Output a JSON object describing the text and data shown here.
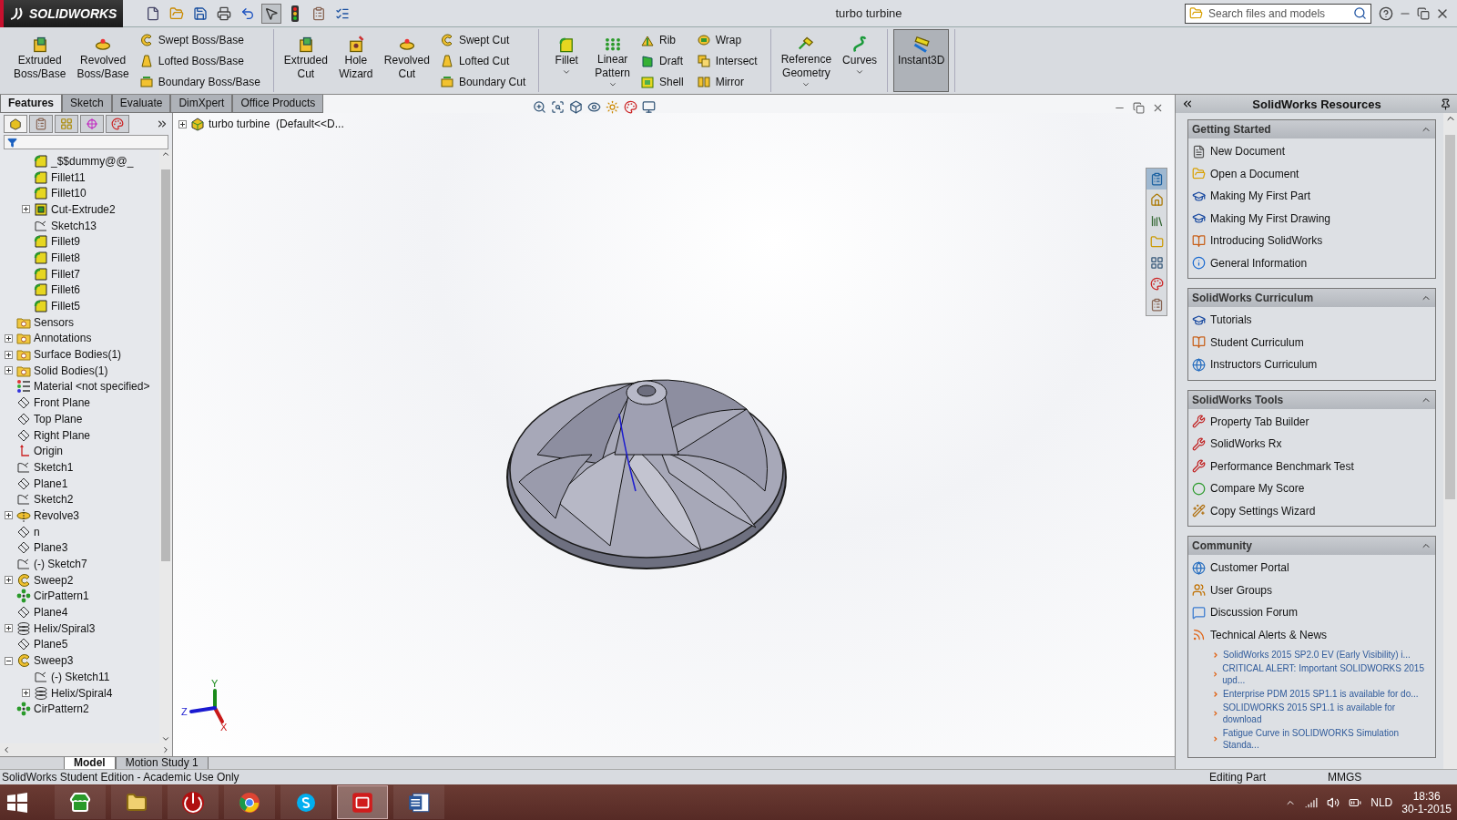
{
  "app": {
    "logo": "SOLIDWORKS",
    "title": "turbo turbine",
    "search": {
      "placeholder": "Search files and models"
    }
  },
  "command_groups": [
    [
      {
        "kind": "large",
        "label": "Extruded\nBoss/Base"
      },
      {
        "kind": "large",
        "label": "Revolved\nBoss/Base"
      },
      {
        "kind": "small",
        "label": "Swept Boss/Base"
      },
      {
        "kind": "small",
        "label": "Lofted Boss/Base"
      },
      {
        "kind": "small",
        "label": "Boundary Boss/Base"
      }
    ],
    [
      {
        "kind": "large",
        "label": "Extruded\nCut"
      },
      {
        "kind": "large",
        "label": "Hole\nWizard"
      },
      {
        "kind": "large",
        "label": "Revolved\nCut"
      },
      {
        "kind": "small",
        "label": "Swept Cut"
      },
      {
        "kind": "small",
        "label": "Lofted Cut"
      },
      {
        "kind": "small",
        "label": "Boundary Cut"
      }
    ],
    [
      {
        "kind": "large",
        "label": "Fillet",
        "dropdown": true
      },
      {
        "kind": "large",
        "label": "Linear\nPattern",
        "dropdown": true
      },
      {
        "kind": "small",
        "label": "Rib"
      },
      {
        "kind": "small",
        "label": "Draft"
      },
      {
        "kind": "small",
        "label": "Shell"
      },
      {
        "kind": "small",
        "label": "Wrap"
      },
      {
        "kind": "small",
        "label": "Intersect"
      },
      {
        "kind": "small",
        "label": "Mirror"
      }
    ],
    [
      {
        "kind": "large",
        "label": "Reference\nGeometry",
        "dropdown": true
      },
      {
        "kind": "large",
        "label": "Curves",
        "dropdown": true
      }
    ],
    [
      {
        "kind": "large",
        "label": "Instant3D",
        "selected": true
      }
    ]
  ],
  "tabs": [
    {
      "label": "Features",
      "selected": true
    },
    {
      "label": "Sketch",
      "selected": false
    },
    {
      "label": "Evaluate",
      "selected": false
    },
    {
      "label": "DimXpert",
      "selected": false
    },
    {
      "label": "Office Products",
      "selected": false
    }
  ],
  "tree": {
    "root": "turbo turbine  (Default<<D...",
    "items": [
      {
        "children": [
          {
            "label": "_$$dummy@@_",
            "kind": "feature"
          },
          {
            "label": "Fillet11",
            "kind": "feature"
          },
          {
            "label": "Fillet10",
            "kind": "feature"
          },
          {
            "label": "Cut-Extrude2",
            "kind": "cut",
            "expanded": false
          },
          {
            "label": "Sketch13",
            "kind": "sketch"
          },
          {
            "label": "Fillet9",
            "kind": "feature"
          },
          {
            "label": "Fillet8",
            "kind": "feature"
          },
          {
            "label": "Fillet7",
            "kind": "feature"
          },
          {
            "label": "Fillet6",
            "kind": "feature"
          },
          {
            "label": "Fillet5",
            "kind": "feature"
          }
        ]
      },
      {
        "label": "Sensors",
        "kind": "folder"
      },
      {
        "label": "Annotations",
        "kind": "folder",
        "expanded": false
      },
      {
        "label": "Surface Bodies(1)",
        "kind": "folder",
        "expanded": false
      },
      {
        "label": "Solid Bodies(1)",
        "kind": "folder",
        "expanded": false
      },
      {
        "label": "Material <not specified>",
        "kind": "material"
      },
      {
        "label": "Front Plane",
        "kind": "plane"
      },
      {
        "label": "Top Plane",
        "kind": "plane"
      },
      {
        "label": "Right Plane",
        "kind": "plane"
      },
      {
        "label": "Origin",
        "kind": "origin"
      },
      {
        "label": "Sketch1",
        "kind": "sketch"
      },
      {
        "label": "Plane1",
        "kind": "plane"
      },
      {
        "label": "Sketch2",
        "kind": "sketch"
      },
      {
        "label": "Revolve3",
        "kind": "revolve",
        "expanded": false
      },
      {
        "label": "n",
        "kind": "plane"
      },
      {
        "label": "Plane3",
        "kind": "plane"
      },
      {
        "label": "(-) Sketch7",
        "kind": "sketch"
      },
      {
        "label": "Sweep2",
        "kind": "sweep",
        "expanded": false
      },
      {
        "label": "CirPattern1",
        "kind": "pattern"
      },
      {
        "label": "Plane4",
        "kind": "plane"
      },
      {
        "label": "Helix/Spiral3",
        "kind": "helix",
        "expanded": false
      },
      {
        "label": "Plane5",
        "kind": "plane"
      },
      {
        "label": "Sweep3",
        "kind": "sweep",
        "expanded": true,
        "children": [
          {
            "label": "(-) Sketch11",
            "kind": "sketch"
          },
          {
            "label": "Helix/Spiral4",
            "kind": "helix",
            "expanded": false
          }
        ]
      },
      {
        "label": "CirPattern2",
        "kind": "pattern"
      }
    ]
  },
  "triad": [
    "X",
    "Y",
    "Z"
  ],
  "task_pane": {
    "title": "SolidWorks Resources",
    "sections": [
      {
        "title": "Getting Started",
        "expanded": true,
        "items": [
          {
            "label": "New Document",
            "kind": "document"
          },
          {
            "label": "Open a Document",
            "kind": "folder"
          },
          {
            "label": "Making My First Part",
            "kind": "cap"
          },
          {
            "label": "Making My First Drawing",
            "kind": "cap"
          },
          {
            "label": "Introducing SolidWorks",
            "kind": "book"
          },
          {
            "label": "General Information",
            "kind": "info"
          }
        ]
      },
      {
        "title": "SolidWorks Curriculum",
        "expanded": true,
        "items": [
          {
            "label": "Tutorials",
            "kind": "cap"
          },
          {
            "label": "Student Curriculum",
            "kind": "book"
          },
          {
            "label": "Instructors Curriculum",
            "kind": "globe"
          }
        ]
      },
      {
        "title": "SolidWorks Tools",
        "expanded": true,
        "items": [
          {
            "label": "Property Tab Builder",
            "kind": "tool"
          },
          {
            "label": "SolidWorks Rx",
            "kind": "tool"
          },
          {
            "label": "Performance Benchmark Test",
            "kind": "tool"
          },
          {
            "label": "Compare My Score",
            "kind": "score"
          },
          {
            "label": "Copy Settings Wizard",
            "kind": "wand"
          }
        ]
      },
      {
        "title": "Community",
        "expanded": true,
        "items": [
          {
            "label": "Customer Portal",
            "kind": "globe"
          },
          {
            "label": "User Groups",
            "kind": "users"
          },
          {
            "label": "Discussion Forum",
            "kind": "forum"
          },
          {
            "label": "Technical Alerts & News",
            "kind": "rss"
          }
        ],
        "news": [
          "SolidWorks 2015 SP2.0 EV (Early Visibility) i...",
          "CRITICAL ALERT: Important SOLIDWORKS 2015 upd...",
          "Enterprise PDM 2015 SP1.1 is available for do...",
          "SOLIDWORKS 2015 SP1.1 is available for download",
          "Fatigue Curve in SOLIDWORKS Simulation Standa..."
        ]
      }
    ]
  },
  "bottom_tabs": [
    {
      "label": "Model",
      "selected": true
    },
    {
      "label": "Motion Study 1",
      "selected": false
    }
  ],
  "status_bar": {
    "message": "SolidWorks Student Edition - Academic Use Only",
    "mode": "Editing Part",
    "units": "MMGS"
  },
  "taskbar": {
    "apps": [
      {
        "kind": "store",
        "selected": false
      },
      {
        "kind": "explorer",
        "selected": false
      },
      {
        "kind": "power",
        "selected": false
      },
      {
        "kind": "chrome",
        "selected": false
      },
      {
        "kind": "skype",
        "selected": false
      },
      {
        "kind": "solidworks",
        "selected": true
      },
      {
        "kind": "word",
        "selected": false
      }
    ],
    "language": "NLD",
    "time": "18:36",
    "date": "30-1-2015"
  }
}
